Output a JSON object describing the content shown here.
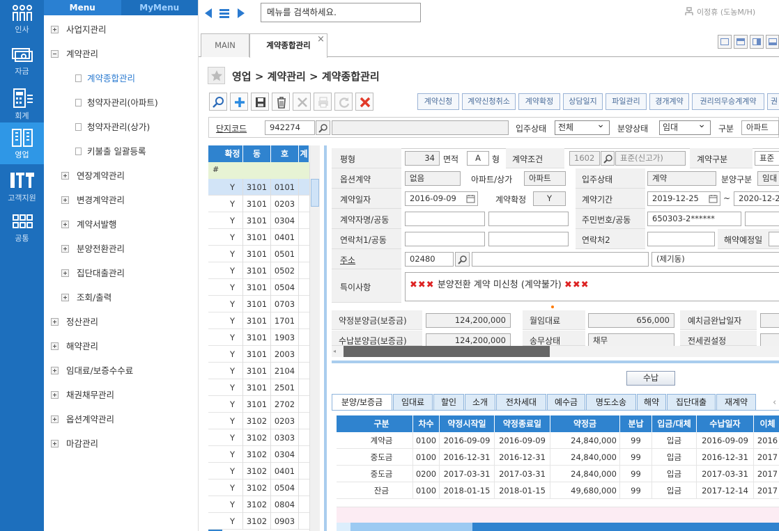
{
  "rail": [
    {
      "label": "인사",
      "icon": "people-icon"
    },
    {
      "label": "자금",
      "icon": "money-icon"
    },
    {
      "label": "회계",
      "icon": "calculator-icon"
    },
    {
      "label": "영업",
      "icon": "building-icon"
    },
    {
      "label": "고객지원",
      "icon": "support-icon"
    },
    {
      "label": "공통",
      "icon": "grid-icon"
    }
  ],
  "menu": {
    "tab_menu": "Menu",
    "tab_mymenu": "MyMenu",
    "items": [
      {
        "label": "사업지관리",
        "level": 0,
        "state": "plus"
      },
      {
        "label": "계약관리",
        "level": 0,
        "state": "minus"
      },
      {
        "label": "계약종합관리",
        "level": 2,
        "state": "doc",
        "active": true
      },
      {
        "label": "청약자관리(아파트)",
        "level": 2,
        "state": "doc"
      },
      {
        "label": "청약자관리(상가)",
        "level": 2,
        "state": "doc"
      },
      {
        "label": "키불출 일괄등록",
        "level": 2,
        "state": "doc"
      },
      {
        "label": "연장계약관리",
        "level": 1,
        "state": "plus"
      },
      {
        "label": "변경계약관리",
        "level": 1,
        "state": "plus"
      },
      {
        "label": "계약서발행",
        "level": 1,
        "state": "plus"
      },
      {
        "label": "분양전환관리",
        "level": 1,
        "state": "plus"
      },
      {
        "label": "집단대출관리",
        "level": 1,
        "state": "plus"
      },
      {
        "label": "조회/출력",
        "level": 1,
        "state": "plus"
      },
      {
        "label": "정산관리",
        "level": 0,
        "state": "plus"
      },
      {
        "label": "해약관리",
        "level": 0,
        "state": "plus"
      },
      {
        "label": "임대료/보증수수료",
        "level": 0,
        "state": "plus"
      },
      {
        "label": "채권채무관리",
        "level": 0,
        "state": "plus"
      },
      {
        "label": "옵션계약관리",
        "level": 0,
        "state": "plus"
      },
      {
        "label": "마감관리",
        "level": 0,
        "state": "plus"
      }
    ]
  },
  "topbar": {
    "search_placeholder": "메뉴를 검색하세요.",
    "user": "이정휴 (도농M/H)"
  },
  "tabs": {
    "main": "MAIN",
    "active": "계약종합관리",
    "close": "×"
  },
  "breadcrumb": "영업 > 계약관리 > 계약종합관리",
  "action_buttons": [
    "계약신청",
    "계약신청취소",
    "계약확정",
    "상담일지",
    "파일관리",
    "경개계약",
    "권리의무승계계약",
    "권"
  ],
  "filter": {
    "complex_code_label": "단지코드",
    "complex_code": "942274",
    "move_status_label": "입주상태",
    "move_status": "전체",
    "sale_status_label": "분양상태",
    "sale_status": "임대",
    "type_label": "구분",
    "type": "아파트"
  },
  "grid": {
    "headers": [
      "확정",
      "동",
      "호",
      "계"
    ],
    "hash": "#",
    "rows": [
      [
        "Y",
        "3101",
        "0101"
      ],
      [
        "Y",
        "3101",
        "0203"
      ],
      [
        "Y",
        "3101",
        "0304"
      ],
      [
        "Y",
        "3101",
        "0401"
      ],
      [
        "Y",
        "3101",
        "0501"
      ],
      [
        "Y",
        "3101",
        "0502"
      ],
      [
        "Y",
        "3101",
        "0504"
      ],
      [
        "Y",
        "3101",
        "0703"
      ],
      [
        "Y",
        "3101",
        "1701"
      ],
      [
        "Y",
        "3101",
        "1903"
      ],
      [
        "Y",
        "3101",
        "2003"
      ],
      [
        "Y",
        "3101",
        "2104"
      ],
      [
        "Y",
        "3101",
        "2501"
      ],
      [
        "Y",
        "3101",
        "2702"
      ],
      [
        "Y",
        "3102",
        "0203"
      ],
      [
        "Y",
        "3102",
        "0303"
      ],
      [
        "Y",
        "3102",
        "0304"
      ],
      [
        "Y",
        "3102",
        "0401"
      ],
      [
        "Y",
        "3102",
        "0504"
      ],
      [
        "Y",
        "3102",
        "0804"
      ],
      [
        "Y",
        "3102",
        "0903"
      ]
    ]
  },
  "form": {
    "pyeong_label": "평형",
    "pyeong": "34",
    "area_label": "면적",
    "area": "A",
    "type_suffix": "형",
    "terms_label": "계약조건",
    "terms_code": "1602",
    "terms_value": "표준(신고가)",
    "contract_type_label": "계약구분",
    "contract_type": "표준",
    "option_label": "옵션계약",
    "option": "없음",
    "apt_store_label": "아파트/상가",
    "apt_store": "아파트",
    "move_status_label": "입주상태",
    "move_status": "계약",
    "sale_type_label": "분양구분",
    "sale_type": "임대",
    "contract_date_label": "계약일자",
    "contract_date": "2016-09-09",
    "confirmed_label": "계약확정",
    "confirmed": "Y",
    "period_label": "계약기간",
    "period_from": "2019-12-25",
    "period_sep": "~",
    "period_to": "2020-12-2",
    "name_label": "계약자명/공동",
    "resident_label": "주민번호/공동",
    "resident": "650303-2******",
    "contact1_label": "연락처1/공동",
    "contact2_label": "연락처2",
    "cancel_date_label": "해약예정일",
    "address_label": "주소",
    "zip": "02480",
    "addr_extra": "(제기동)",
    "note_label": "특이사항",
    "note": "분양전환 계약 미신청 (계약불가)",
    "deposit_label": "약정분양금(보증금)",
    "deposit": "124,200,000",
    "monthly_rent_label": "월임대료",
    "monthly_rent": "656,000",
    "deposit_done_label": "예치금완납일자",
    "paid_deposit_label": "수납분양금(보증금)",
    "paid_deposit": "124,200,000",
    "litigation_label": "송무상태",
    "litigation": "채무",
    "lease_right_label": "전세권설정"
  },
  "receive_button": "수납",
  "sub_tabs": [
    "분양/보증금",
    "임대료",
    "할인",
    "소개",
    "전차세대",
    "예수금",
    "명도소송",
    "해약",
    "집단대출",
    "재계약"
  ],
  "payments": {
    "headers": [
      "구분",
      "차수",
      "약정시작일",
      "약정종료일",
      "약정금",
      "분납",
      "입금/대체",
      "수납일자",
      "이체"
    ],
    "rows": [
      [
        "계약금",
        "0100",
        "2016-09-09",
        "2016-09-09",
        "24,840,000",
        "99",
        "입금",
        "2016-09-09",
        "2016"
      ],
      [
        "중도금",
        "0100",
        "2016-12-31",
        "2016-12-31",
        "24,840,000",
        "99",
        "입금",
        "2016-12-31",
        "2017"
      ],
      [
        "중도금",
        "0200",
        "2017-03-31",
        "2017-03-31",
        "24,840,000",
        "99",
        "입금",
        "2017-03-31",
        "2017"
      ],
      [
        "잔금",
        "0100",
        "2018-01-15",
        "2018-01-15",
        "49,680,000",
        "99",
        "입금",
        "2017-12-14",
        "2017"
      ]
    ]
  }
}
